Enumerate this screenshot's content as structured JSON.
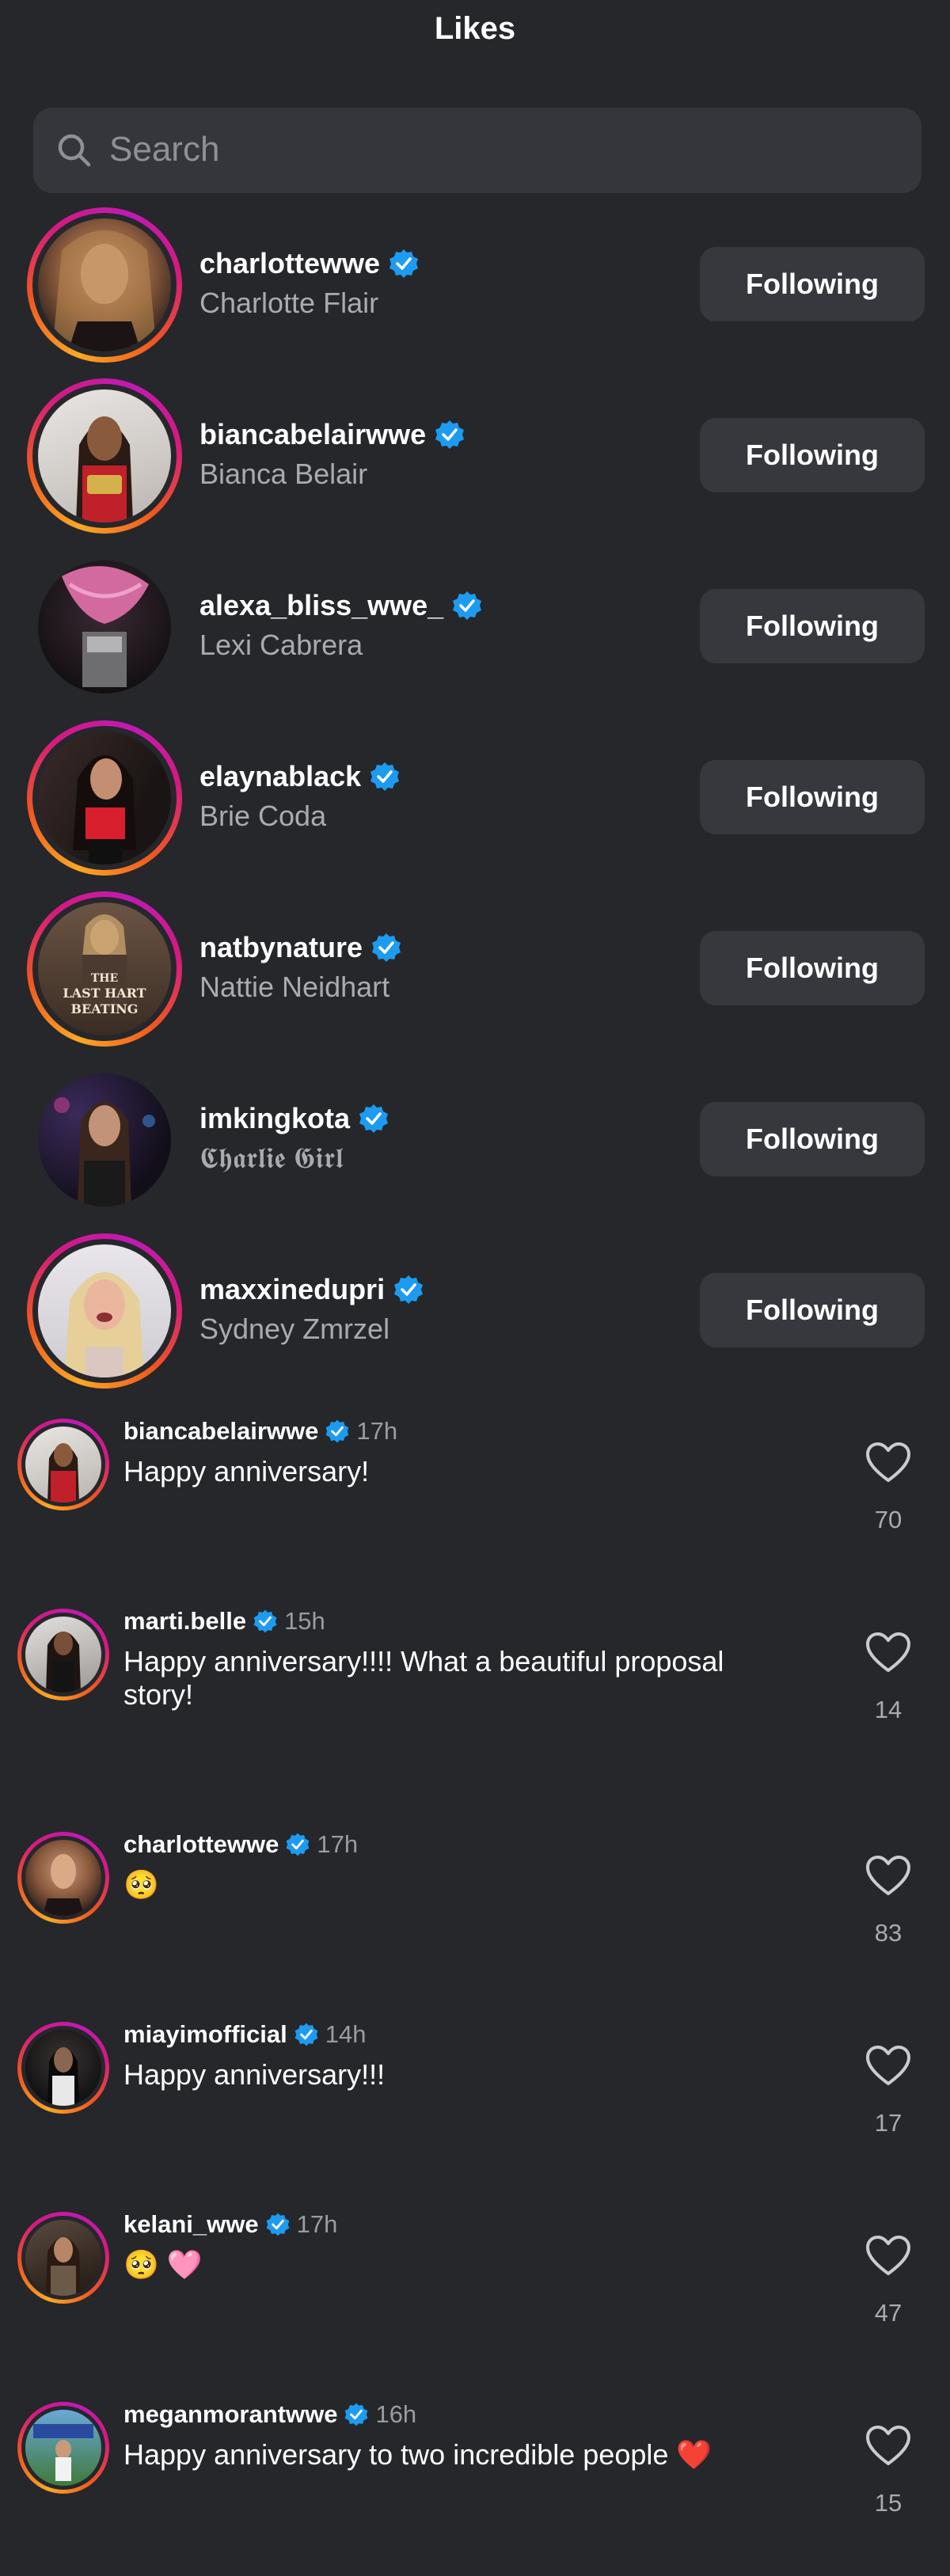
{
  "header": {
    "title": "Likes"
  },
  "search": {
    "placeholder": "Search",
    "icon": "search-icon"
  },
  "users": [
    {
      "username": "charlottewwe",
      "fullname": "Charlotte Flair",
      "verified": true,
      "button": "Following",
      "story_ring": true
    },
    {
      "username": "biancabelairwwe",
      "fullname": "Bianca Belair",
      "verified": true,
      "button": "Following",
      "story_ring": true
    },
    {
      "username": "alexa_bliss_wwe_",
      "fullname": "Lexi Cabrera",
      "verified": true,
      "button": "Following",
      "story_ring": false
    },
    {
      "username": "elaynablack",
      "fullname": "Brie Coda",
      "verified": true,
      "button": "Following",
      "story_ring": true
    },
    {
      "username": "natbynature",
      "fullname": "Nattie Neidhart",
      "verified": true,
      "button": "Following",
      "story_ring": true,
      "avatar_text": "THE LAST HART BEATING"
    },
    {
      "username": "imkingkota",
      "fullname": "𝕮𝖍𝖆𝖗𝖑𝖎𝖊 𝕲𝖎𝖗𝖑",
      "verified": true,
      "button": "Following",
      "story_ring": false
    },
    {
      "username": "maxxinedupri",
      "fullname": "Sydney Zmrzel",
      "verified": true,
      "button": "Following",
      "story_ring": true
    }
  ],
  "comments": [
    {
      "username": "biancabelairwwe",
      "time": "17h",
      "text": "Happy anniversary!",
      "likes": "70"
    },
    {
      "username": "marti.belle",
      "time": "15h",
      "text": "Happy anniversary!!!! What a beautiful proposal story!",
      "likes": "14"
    },
    {
      "username": "charlottewwe",
      "time": "17h",
      "text": "🥺",
      "likes": "83"
    },
    {
      "username": "miayimofficial",
      "time": "14h",
      "text": "Happy anniversary!!!",
      "likes": "17"
    },
    {
      "username": "kelani_wwe",
      "time": "17h",
      "text": "🥺 🩷",
      "likes": "47"
    },
    {
      "username": "meganmorantwwe",
      "time": "16h",
      "text": "Happy anniversary to two incredible people ❤️",
      "likes": "15"
    }
  ],
  "colors": {
    "background": "#25272b",
    "button": "#36383d",
    "verified": "#1d9bf0",
    "ring_start": "#f9a825",
    "ring_end": "#c01ab4"
  }
}
